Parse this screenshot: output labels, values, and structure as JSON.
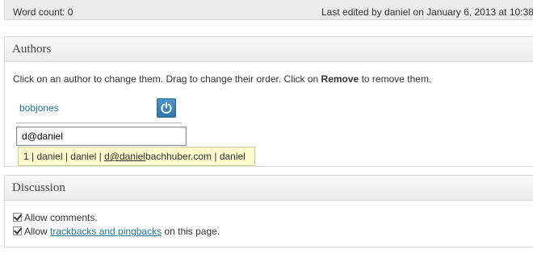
{
  "status": {
    "word_count": "Word count: 0",
    "last_edited": "Last edited by daniel on January 6, 2013 at 10:38"
  },
  "authors_box": {
    "title": "Authors",
    "instructions_pre": "Click on an author to change them. Drag to change their order. Click on ",
    "instructions_bold": "Remove",
    "instructions_post": " to remove them.",
    "author_name": "bobjones",
    "remove_icon": "power-icon",
    "input_value": "d@daniel",
    "suggestion_pre": "1 | daniel | daniel | ",
    "suggestion_match": "d@daniel",
    "suggestion_post": "bachhuber.com | daniel"
  },
  "discussion_box": {
    "title": "Discussion",
    "allow_comments_label": "Allow comments.",
    "allow_prefix": "Allow ",
    "trackbacks_link": "trackbacks and pingbacks",
    "allow_suffix": " on this page."
  },
  "colors": {
    "link": "#21759b",
    "suggestion_bg": "#fffbcc",
    "power_button": "#2f76ab"
  }
}
